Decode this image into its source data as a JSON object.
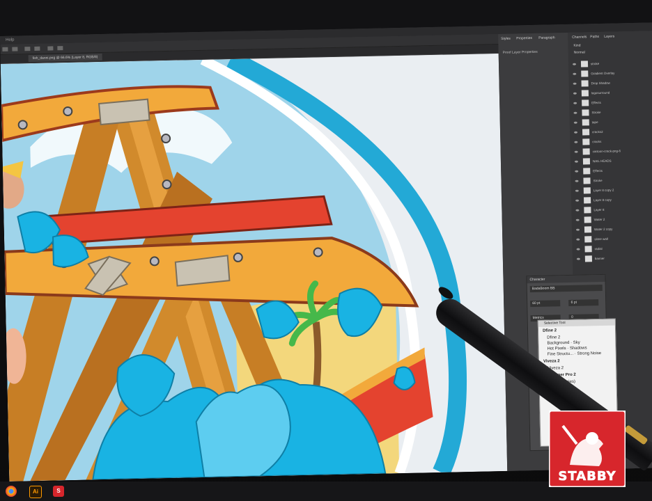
{
  "app": {
    "menu_label": "Help",
    "document_tab": "fish_danni.png @ 66.6% (Layer 8, RGB/8)",
    "zoom_field": "100%"
  },
  "panels": {
    "top_tabs": [
      "Styles",
      "Properties",
      "Paragraph"
    ],
    "right_tabs": [
      "Channels",
      "Paths",
      "Layers"
    ],
    "properties_title": "Proof Layer Properties",
    "layer_kind": "Kind",
    "blend_mode": "Normal"
  },
  "layers": [
    "stroke",
    "Gradient Overlay",
    "Drop Shadow",
    "logosurround",
    "Effects",
    "Stroke",
    "tape",
    "cracks2",
    "cracks",
    "cartoon-crack-png-6",
    "NAIL HEADS",
    "Effects",
    "Stroke",
    "Layer 8 copy 2",
    "Layer 8 copy",
    "Layer 8",
    "Water 2",
    "Water 2 copy",
    "slime wall",
    "radial",
    "banner"
  ],
  "character_panel": {
    "title": "Character",
    "font": "BadaBoom BB",
    "size": "60 pt",
    "leading": "6 pt",
    "tracking_label": "Metrics",
    "tracking_value": "0",
    "scale": "100%"
  },
  "selective_tool": {
    "title": "Selective Tool",
    "sections": [
      {
        "name": "Dfine 2",
        "items": [
          "Dfine 2",
          "Skin",
          "Background",
          "Sky",
          "Hot Pixels",
          "Shadows",
          "Fine Structu...",
          "Strong Noise"
        ]
      },
      {
        "name": "Viveza 2",
        "items": [
          "Viveza 2"
        ]
      },
      {
        "name": "Sharpener Pro 2",
        "items": [
          "(Image Series)",
          "(Image)"
        ]
      }
    ]
  },
  "taskbar": {
    "apps": [
      {
        "name": "chrome",
        "label": ""
      },
      {
        "name": "illustrator",
        "label": "Ai"
      },
      {
        "name": "stabby",
        "label": "S"
      }
    ]
  },
  "watermark": {
    "text": "STABBY"
  },
  "colors": {
    "sky_blue": "#9fd4ea",
    "water_blue": "#19b3e3",
    "wood": "#e29a2a",
    "beam_orange": "#f2a93b",
    "ring_blue": "#23a9d6",
    "sand": "#f3d77c",
    "banner_red": "#e4432f",
    "logo_red": "#d7262c"
  }
}
